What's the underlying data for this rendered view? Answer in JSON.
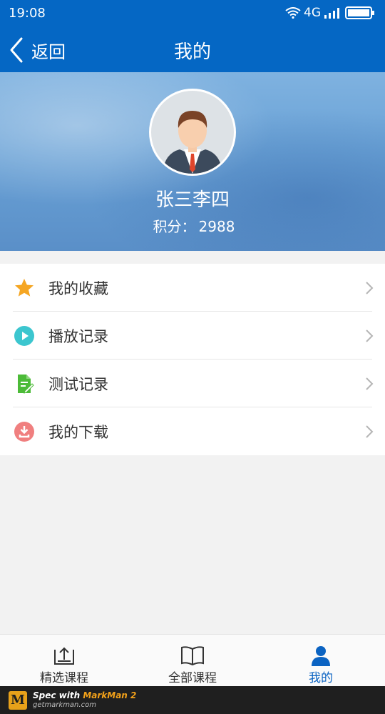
{
  "status_bar": {
    "time": "19:08",
    "network": "4G"
  },
  "nav": {
    "back_label": "返回",
    "title": "我的"
  },
  "profile": {
    "name": "张三李四",
    "points_label": "积分：",
    "points_value": "2988"
  },
  "menu": [
    {
      "label": "我的收藏",
      "icon": "star-icon",
      "color": "#f5a623"
    },
    {
      "label": "播放记录",
      "icon": "play-icon",
      "color": "#3cc6cf"
    },
    {
      "label": "测试记录",
      "icon": "document-edit-icon",
      "color": "#4cbb38"
    },
    {
      "label": "我的下载",
      "icon": "download-icon",
      "color": "#f07f7f"
    }
  ],
  "tabs": [
    {
      "label": "精选课程",
      "icon": "featured-icon",
      "active": false
    },
    {
      "label": "全部课程",
      "icon": "book-icon",
      "active": false
    },
    {
      "label": "我的",
      "icon": "person-icon",
      "active": true
    }
  ],
  "footer": {
    "prefix": "Spec with ",
    "brand": "MarkMan 2",
    "url": "getmarkman.com"
  },
  "colors": {
    "primary": "#0567c4",
    "active_tab": "#0b63c2",
    "background": "#f2f2f2"
  }
}
